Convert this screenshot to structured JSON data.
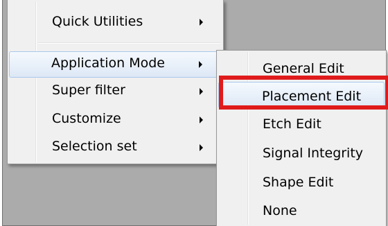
{
  "context_menu": {
    "items": [
      {
        "label": "Quick Utilities",
        "has_submenu": true
      },
      {
        "label": "Application Mode",
        "has_submenu": true,
        "highlighted": true
      },
      {
        "label": "Super filter",
        "has_submenu": true
      },
      {
        "label": "Customize",
        "has_submenu": true
      },
      {
        "label": "Selection set",
        "has_submenu": true
      }
    ]
  },
  "submenu": {
    "parent": "Application Mode",
    "items": [
      {
        "label": "General Edit"
      },
      {
        "label": "Placement Edit",
        "highlighted": true,
        "callout": true
      },
      {
        "label": "Etch Edit"
      },
      {
        "label": "Signal Integrity"
      },
      {
        "label": "Shape Edit"
      },
      {
        "label": "None"
      }
    ]
  },
  "colors": {
    "callout": "#e01b1b",
    "highlight_border": "#a8c8eb",
    "menu_background": "#f0f0f0",
    "backdrop": "#ababab"
  }
}
